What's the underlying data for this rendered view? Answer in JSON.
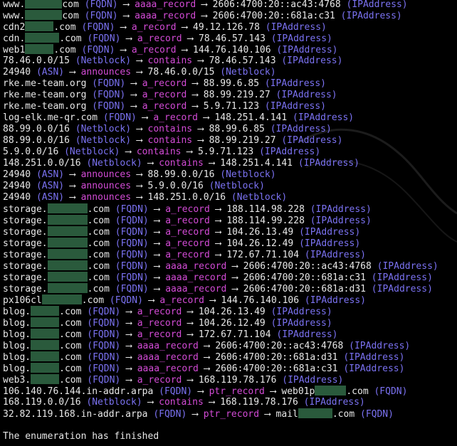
{
  "lines": [
    {
      "n1": "www.",
      "mask": 52,
      "n2": "com",
      "t1": " (FQDN)",
      "rel": "aaaa_record",
      "v": "2606:4700:20::ac43:4768",
      "t2": " (IPAddress)"
    },
    {
      "n1": "www.",
      "mask": 52,
      "n2": "com",
      "t1": " (FQDN)",
      "rel": "aaaa_record",
      "v": "2606:4700:20::681a:c31",
      "t2": " (IPAddress)"
    },
    {
      "n1": "cdn2",
      "mask": 40,
      "n2": ".com",
      "t1": " (FQDN)",
      "rel": "a_record",
      "v": "49.12.126.78",
      "t2": " (IPAddress)"
    },
    {
      "n1": "cdn.",
      "mask": 48,
      "n2": ".com",
      "t1": " (FQDN)",
      "rel": "a_record",
      "v": "78.46.57.143",
      "t2": " (IPAddress)"
    },
    {
      "n1": "web1",
      "mask": 40,
      "n2": ".com",
      "t1": " (FQDN)",
      "rel": "a_record",
      "v": "144.76.140.106",
      "t2": " (IPAddress)"
    },
    {
      "n1": "78.46.0.0/15",
      "mask": 0,
      "n2": "",
      "t1": " (Netblock)",
      "rel": "contains",
      "v": "78.46.57.143",
      "t2": " (IPAddress)"
    },
    {
      "n1": "24940",
      "mask": 0,
      "n2": "",
      "t1": " (ASN)",
      "rel": "announces",
      "v": "78.46.0.0/15",
      "t2": " (Netblock)"
    },
    {
      "n1": "rke.me-team.org",
      "mask": 0,
      "n2": "",
      "t1": " (FQDN)",
      "rel": "a_record",
      "v": "88.99.6.85",
      "t2": " (IPAddress)"
    },
    {
      "n1": "rke.me-team.org",
      "mask": 0,
      "n2": "",
      "t1": " (FQDN)",
      "rel": "a_record",
      "v": "88.99.219.27",
      "t2": " (IPAddress)"
    },
    {
      "n1": "rke.me-team.org",
      "mask": 0,
      "n2": "",
      "t1": " (FQDN)",
      "rel": "a_record",
      "v": "5.9.71.123",
      "t2": " (IPAddress)"
    },
    {
      "n1": "log-elk.me-qr.com",
      "mask": 0,
      "n2": "",
      "t1": " (FQDN)",
      "rel": "a_record",
      "v": "148.251.4.141",
      "t2": " (IPAddress)"
    },
    {
      "n1": "88.99.0.0/16",
      "mask": 0,
      "n2": "",
      "t1": " (Netblock)",
      "rel": "contains",
      "v": "88.99.6.85",
      "t2": " (IPAddress)"
    },
    {
      "n1": "88.99.0.0/16",
      "mask": 0,
      "n2": "",
      "t1": " (Netblock)",
      "rel": "contains",
      "v": "88.99.219.27",
      "t2": " (IPAddress)"
    },
    {
      "n1": "5.9.0.0/16",
      "mask": 0,
      "n2": "",
      "t1": " (Netblock)",
      "rel": "contains",
      "v": "5.9.71.123",
      "t2": " (IPAddress)"
    },
    {
      "n1": "148.251.0.0/16",
      "mask": 0,
      "n2": "",
      "t1": " (Netblock)",
      "rel": "contains",
      "v": "148.251.4.141",
      "t2": " (IPAddress)"
    },
    {
      "n1": "24940",
      "mask": 0,
      "n2": "",
      "t1": " (ASN)",
      "rel": "announces",
      "v": "88.99.0.0/16",
      "t2": " (Netblock)"
    },
    {
      "n1": "24940",
      "mask": 0,
      "n2": "",
      "t1": " (ASN)",
      "rel": "announces",
      "v": "5.9.0.0/16",
      "t2": " (Netblock)"
    },
    {
      "n1": "24940",
      "mask": 0,
      "n2": "",
      "t1": " (ASN)",
      "rel": "announces",
      "v": "148.251.0.0/16",
      "t2": " (Netblock)"
    },
    {
      "n1": "storage.",
      "mask": 56,
      "n2": ".com",
      "t1": " (FQDN)",
      "rel": "a_record",
      "v": "188.114.98.228",
      "t2": " (IPAddress)"
    },
    {
      "n1": "storage.",
      "mask": 56,
      "n2": ".com",
      "t1": " (FQDN)",
      "rel": "a_record",
      "v": "188.114.99.228",
      "t2": " (IPAddress)"
    },
    {
      "n1": "storage.",
      "mask": 56,
      "n2": ".com",
      "t1": " (FQDN)",
      "rel": "a_record",
      "v": "104.26.13.49",
      "t2": " (IPAddress)"
    },
    {
      "n1": "storage.",
      "mask": 56,
      "n2": ".com",
      "t1": " (FQDN)",
      "rel": "a_record",
      "v": "104.26.12.49",
      "t2": " (IPAddress)"
    },
    {
      "n1": "storage.",
      "mask": 56,
      "n2": ".com",
      "t1": " (FQDN)",
      "rel": "a_record",
      "v": "172.67.71.104",
      "t2": " (IPAddress)"
    },
    {
      "n1": "storage.",
      "mask": 56,
      "n2": ".com",
      "t1": " (FQDN)",
      "rel": "aaaa_record",
      "v": "2606:4700:20::ac43:4768",
      "t2": " (IPAddress)"
    },
    {
      "n1": "storage.",
      "mask": 56,
      "n2": ".com",
      "t1": " (FQDN)",
      "rel": "aaaa_record",
      "v": "2606:4700:20::681a:c31",
      "t2": " (IPAddress)"
    },
    {
      "n1": "storage.",
      "mask": 56,
      "n2": ".com",
      "t1": " (FQDN)",
      "rel": "aaaa_record",
      "v": "2606:4700:20::681a:d31",
      "t2": " (IPAddress)"
    },
    {
      "n1": "px106cl",
      "mask": 56,
      "n2": ".com",
      "t1": " (FQDN)",
      "rel": "a_record",
      "v": "144.76.140.106",
      "t2": " (IPAddress)"
    },
    {
      "n1": "blog.",
      "mask": 40,
      "n2": ".com",
      "t1": " (FQDN)",
      "rel": "a_record",
      "v": "104.26.13.49",
      "t2": " (IPAddress)"
    },
    {
      "n1": "blog.",
      "mask": 40,
      "n2": ".com",
      "t1": " (FQDN)",
      "rel": "a_record",
      "v": "104.26.12.49",
      "t2": " (IPAddress)"
    },
    {
      "n1": "blog.",
      "mask": 40,
      "n2": ".com",
      "t1": " (FQDN)",
      "rel": "a_record",
      "v": "172.67.71.104",
      "t2": " (IPAddress)"
    },
    {
      "n1": "blog.",
      "mask": 40,
      "n2": ".com",
      "t1": " (FQDN)",
      "rel": "aaaa_record",
      "v": "2606:4700:20::ac43:4768",
      "t2": " (IPAddress)"
    },
    {
      "n1": "blog.",
      "mask": 40,
      "n2": ".com",
      "t1": " (FQDN)",
      "rel": "aaaa_record",
      "v": "2606:4700:20::681a:d31",
      "t2": " (IPAddress)"
    },
    {
      "n1": "blog.",
      "mask": 40,
      "n2": ".com",
      "t1": " (FQDN)",
      "rel": "aaaa_record",
      "v": "2606:4700:20::681a:c31",
      "t2": " (IPAddress)"
    },
    {
      "n1": "web3.",
      "mask": 40,
      "n2": ".com",
      "t1": " (FQDN)",
      "rel": "a_record",
      "v": "168.119.78.176",
      "t2": " (IPAddress)"
    },
    {
      "n1": "106.140.76.144.in-addr.arpa",
      "mask": 0,
      "n2": "",
      "t1": " (FQDN)",
      "rel": "ptr_record",
      "v": "web01p",
      "vmask": 44,
      "v2": ".com",
      "t2": " (FQDN)"
    },
    {
      "n1": "168.119.0.0/16",
      "mask": 0,
      "n2": "",
      "t1": " (Netblock)",
      "rel": "contains",
      "v": "168.119.78.176",
      "t2": " (IPAddress)"
    },
    {
      "n1": "32.82.119.168.in-addr.arpa",
      "mask": 0,
      "n2": "",
      "t1": " (FQDN)",
      "rel": "ptr_record",
      "v": "mail",
      "vmask": 48,
      "v2": ".com",
      "t2": " (FQDN)"
    }
  ],
  "arrow": " ⟶ ",
  "footer_message": "The enumeration has finished",
  "colors": {
    "background": "#000000",
    "name": "#e8e8e8",
    "type": "#7b72f2",
    "relation": "#d34bd6",
    "redaction": "#2a5a3c"
  }
}
